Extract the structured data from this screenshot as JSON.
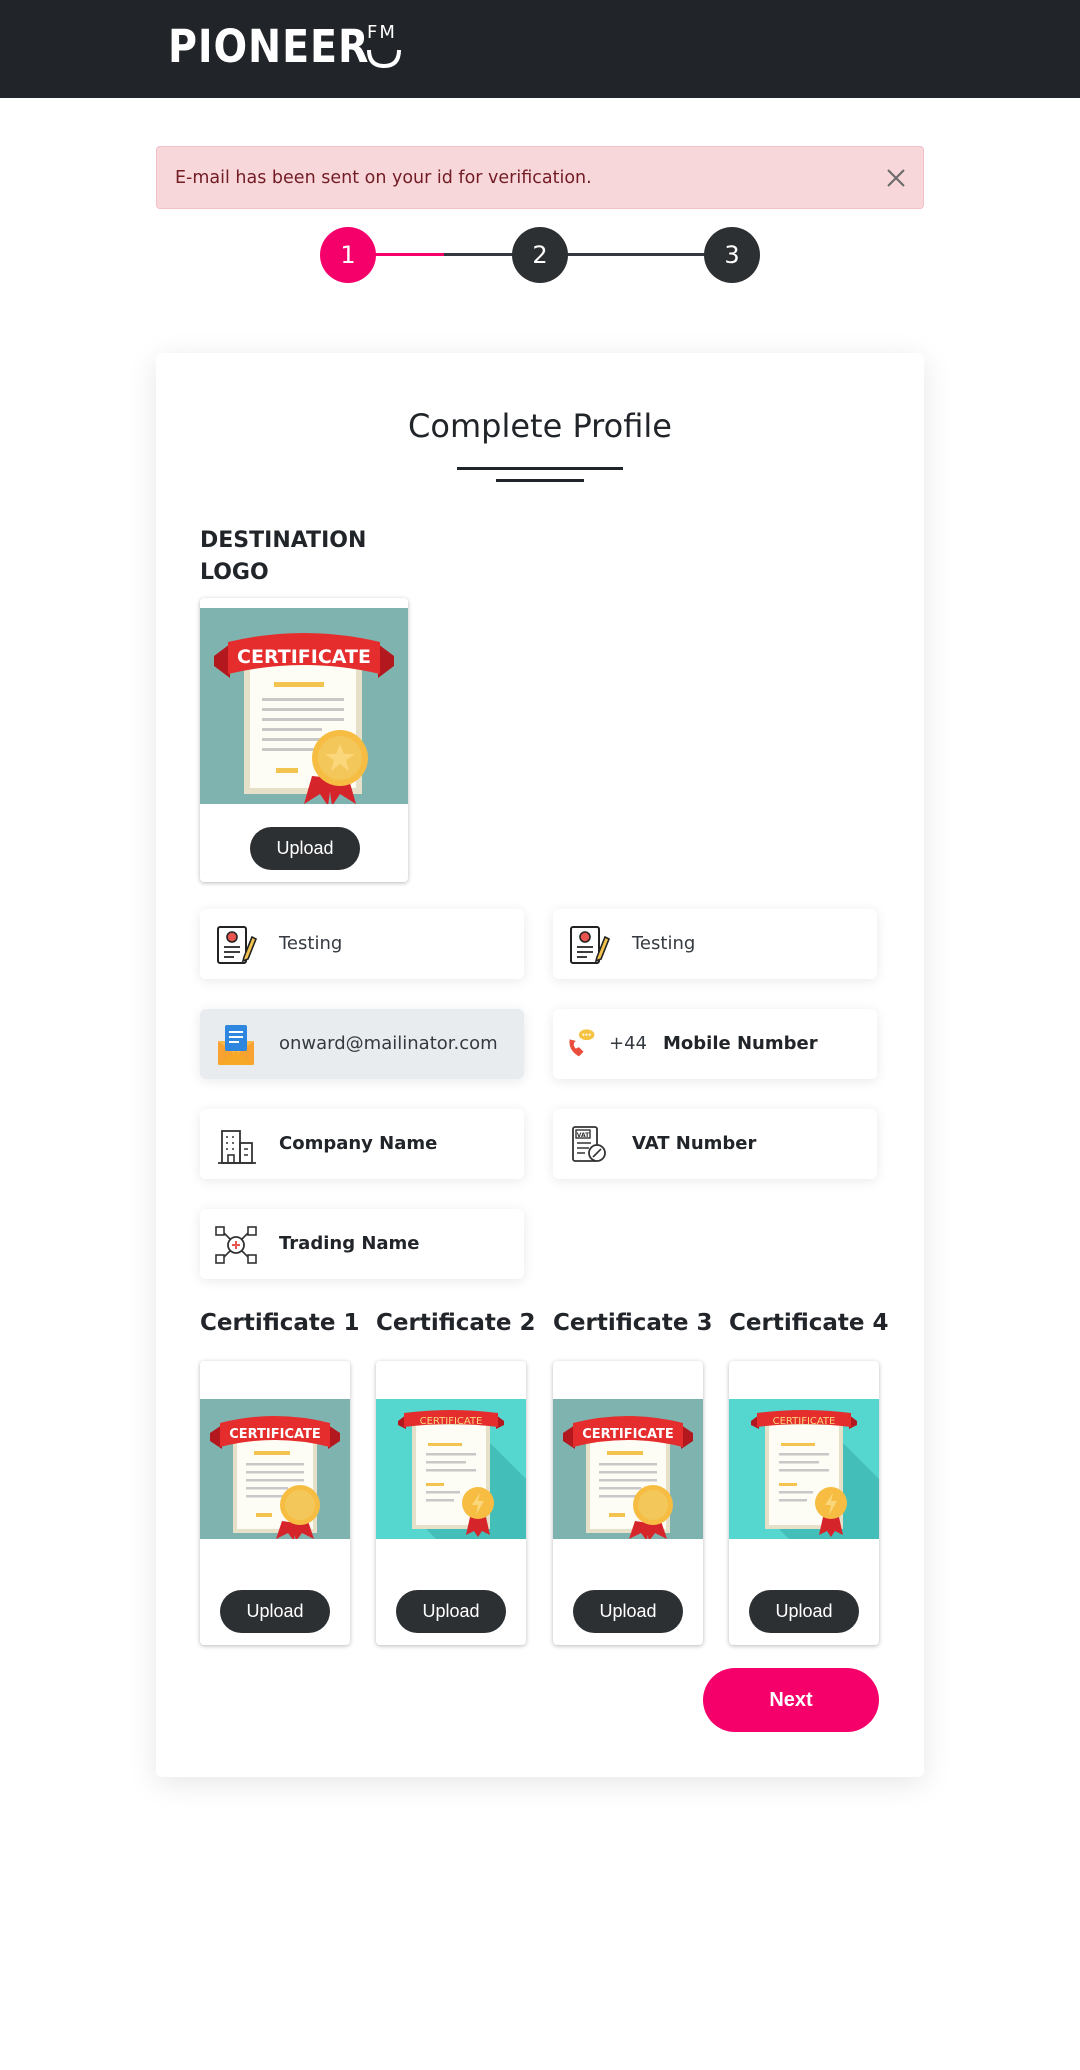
{
  "header": {
    "brand_main": "PIONEER",
    "brand_sub": "FM"
  },
  "alert": {
    "message": "E-mail has been sent on your id for verification.",
    "close_icon": "close-icon"
  },
  "stepper": {
    "steps": [
      "1",
      "2",
      "3"
    ],
    "active_step": 1,
    "active_color": "#f5006b"
  },
  "card": {
    "title": "Complete Profile",
    "destination_logo_label": "DESTINATION LOGO",
    "logo_upload_label": "Upload",
    "fields": {
      "first_name": {
        "value": "Testing",
        "icon": "profile-document-icon"
      },
      "last_name": {
        "value": "Testing",
        "icon": "profile-document-icon"
      },
      "email": {
        "value": "onward@mailinator.com",
        "icon": "email-envelope-icon",
        "disabled": true
      },
      "mobile": {
        "country_code": "+44",
        "placeholder": "Mobile Number",
        "icon": "phone-icon"
      },
      "company": {
        "placeholder": "Company Name",
        "icon": "building-icon"
      },
      "vat": {
        "placeholder": "VAT Number",
        "icon": "vat-document-icon"
      },
      "trading": {
        "placeholder": "Trading Name",
        "icon": "network-icon"
      }
    },
    "certificates": [
      {
        "label": "Certificate 1",
        "upload_label": "Upload",
        "image_text": "CERTIFICATE"
      },
      {
        "label": "Certificate 2",
        "upload_label": "Upload",
        "image_text": "CERTIFICATE"
      },
      {
        "label": "Certificate 3",
        "upload_label": "Upload",
        "image_text": "CERTIFICATE"
      },
      {
        "label": "Certificate 4",
        "upload_label": "Upload",
        "image_text": "CERTIFICATE"
      }
    ],
    "next_label": "Next"
  },
  "colors": {
    "header_bg": "#212428",
    "accent": "#f5006b",
    "dark_button": "#2d3033",
    "alert_bg": "#f8d7da",
    "alert_text": "#721c24"
  }
}
